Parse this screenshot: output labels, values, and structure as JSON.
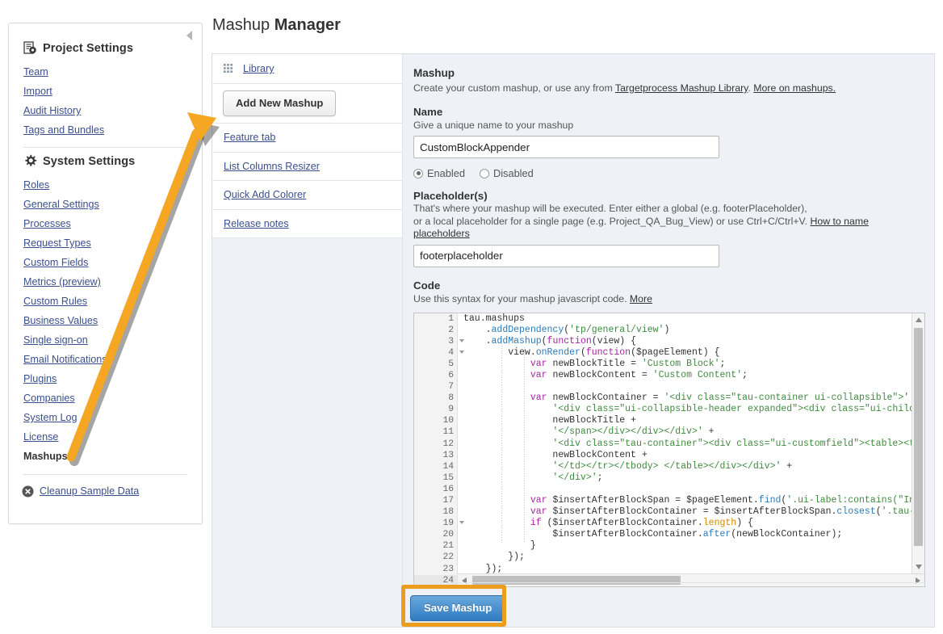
{
  "page": {
    "title_plain": "Mashup ",
    "title_bold": "Manager"
  },
  "sidebar": {
    "collapse_icon": "chevron-left-icon",
    "project_settings": {
      "icon": "project-settings-icon",
      "label": "Project Settings",
      "items": [
        "Team",
        "Import",
        "Audit History",
        "Tags and Bundles"
      ]
    },
    "system_settings": {
      "icon": "gear-icon",
      "label": "System Settings",
      "items": [
        "Roles",
        "General Settings",
        "Processes",
        "Request Types",
        "Custom Fields",
        "Metrics (preview)",
        "Custom Rules",
        "Business Values",
        "Single sign-on",
        "Email Notifications",
        "Plugins",
        "Companies",
        "System Log",
        "License"
      ],
      "current_item": "Mashups"
    },
    "cleanup": {
      "icon": "close-circle-icon",
      "label": "Cleanup Sample Data"
    }
  },
  "mashup_list": {
    "library_icon": "grid-icon",
    "library_label": "Library",
    "add_button": "Add New Mashup",
    "items": [
      "Feature tab",
      "List Columns Resizer",
      "Quick Add Colorer",
      "Release notes"
    ]
  },
  "form": {
    "section_title": "Mashup",
    "section_desc_pre": "Create your custom mashup, or use any from ",
    "section_desc_link1": "Targetprocess Mashup Library",
    "section_desc_mid": ". ",
    "section_desc_link2": "More on mashups.",
    "name_label": "Name",
    "name_hint": "Give a unique name to your mashup",
    "name_value": "CustomBlockAppender",
    "name_placeholder": "",
    "radio_enabled": "Enabled",
    "radio_disabled": "Disabled",
    "radio_selected": "Enabled",
    "placeholder_label": "Placeholder(s)",
    "placeholder_hint_line1": "That's where your mashup will be executed. Enter either a global (e.g. footerPlaceholder),",
    "placeholder_hint_line2": "or a local placeholder for a single page (e.g. Project_QA_Bug_View) or use Ctrl+C/Ctrl+V.",
    "placeholder_hint_link": "How to name placeholders",
    "placeholder_value": "footerplaceholder",
    "code_label": "Code",
    "code_hint": "Use this syntax for your mashup javascript code.",
    "code_hint_link": "More",
    "save_button": "Save Mashup"
  },
  "code_editor": {
    "total_lines": 24,
    "fold_lines": [
      3,
      4,
      19
    ],
    "current_line": 24,
    "lines": [
      "tau.mashups",
      "    .addDependency('tp/general/view')",
      "    .addMashup(function(view) {",
      "        view.onRender(function($pageElement) {",
      "            var newBlockTitle = 'Custom Block';",
      "            var newBlockContent = 'Custom Content';",
      "",
      "            var newBlockContainer = '<div class=\"tau-container ui-collapsible\">' +",
      "                '<div class=\"ui-collapsible-header expanded\"><div class=\"ui-children-c",
      "                newBlockTitle +",
      "                '</span></div></div></div>' +",
      "                '<div class=\"tau-container\"><div class=\"ui-customfield\"><table><tbody>",
      "                newBlockContent +",
      "                '</td></tr></tbody> </table></div></div>' +",
      "                '</div>';",
      "",
      "            var $insertAfterBlockSpan = $pageElement.find('.ui-label:contains(\"Info\")'",
      "            var $insertAfterBlockContainer = $insertAfterBlockSpan.closest('.tau-conta",
      "            if ($insertAfterBlockContainer.length) {",
      "                $insertAfterBlockContainer.after(newBlockContainer);",
      "            }",
      "        });",
      "    });",
      ""
    ]
  },
  "annotations": {
    "arrow_color": "#F5A623",
    "highlight_color": "#EB9D1E",
    "arrow_target": "Add New Mashup",
    "highlight_target": "Save Mashup"
  }
}
